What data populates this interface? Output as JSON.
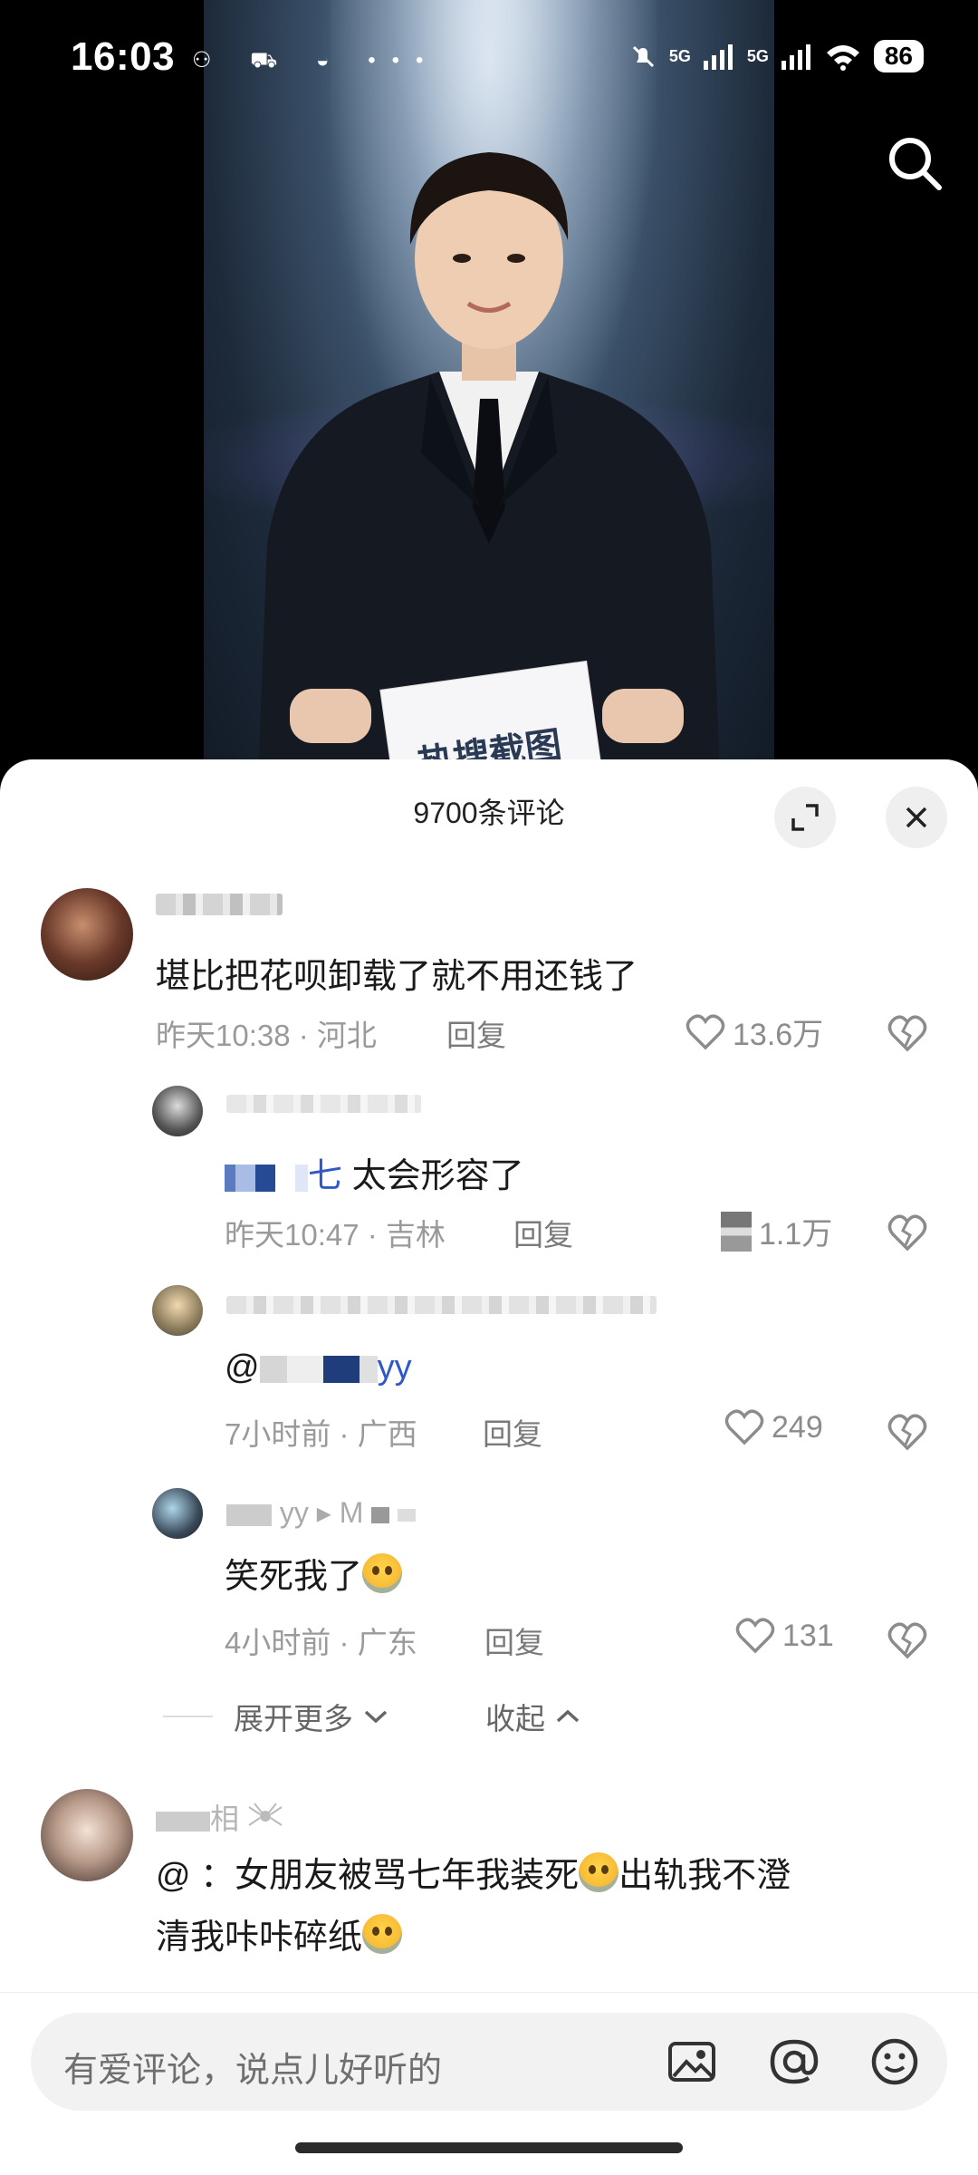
{
  "status_bar": {
    "time": "16:03",
    "left_icons": "⚇ ⛟ ◒ •••",
    "net1": "5G",
    "net2": "5G",
    "battery": "86"
  },
  "video": {
    "card_text": "热搜截图"
  },
  "sheet": {
    "title": "9700条评论"
  },
  "comments": [
    {
      "text": "堪比把花呗卸载了就不用还钱了",
      "time": "昨天10:38",
      "location": "河北",
      "reply": "回复",
      "likes": "13.6万",
      "replies": [
        {
          "text_suffix": "太会形容了",
          "text_prefix": "七",
          "time": "昨天10:47",
          "location": "吉林",
          "reply": "回复",
          "likes": "1.1万"
        },
        {
          "text_prefix": "@",
          "text_suffix": "yy",
          "time": "7小时前",
          "location": "广西",
          "reply": "回复",
          "likes": "249"
        },
        {
          "name_partial": "yy ▸ M",
          "text": "笑死我了",
          "time": "4小时前",
          "location": "广东",
          "reply": "回复",
          "likes": "131"
        }
      ],
      "expand_more": "展开更多",
      "collapse": "收起"
    },
    {
      "name_partial": "相",
      "line1": "@      ：女朋友被骂七年我装死",
      "line1_tail": "出轨我不澄",
      "line2": "清我咔咔碎纸"
    }
  ],
  "input": {
    "placeholder": "有爱评论，说点儿好听的"
  },
  "icons": [
    "search-icon",
    "expand-icon",
    "close-icon",
    "heart-icon",
    "broken-heart-icon",
    "image-icon",
    "at-icon",
    "emoji-icon"
  ],
  "colors": {
    "sheet_bg": "#ffffff",
    "text": "#1a1a1a",
    "meta": "#9a9a9a"
  }
}
